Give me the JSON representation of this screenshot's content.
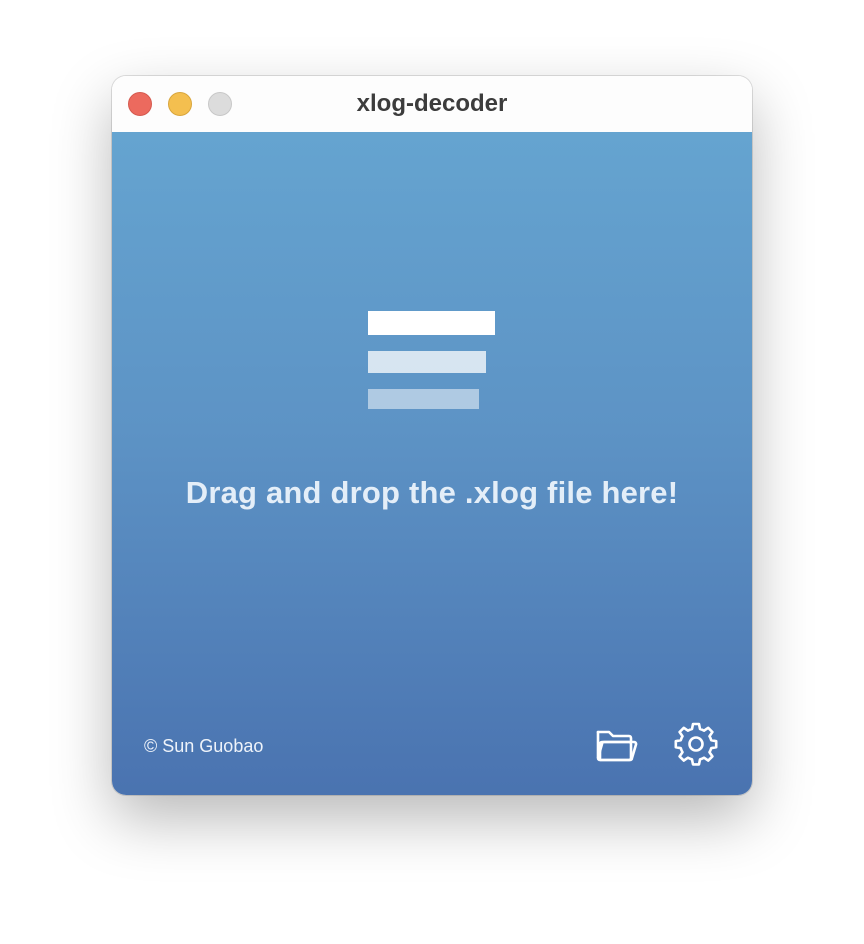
{
  "window": {
    "title": "xlog-decoder"
  },
  "drop_zone": {
    "message": "Drag and drop the .xlog file here!"
  },
  "footer": {
    "copyright": "© Sun Guobao",
    "open_icon": "folder-icon",
    "settings_icon": "gear-icon"
  },
  "colors": {
    "gradient_top": "#65a4d0",
    "gradient_bottom": "#4a73b0",
    "close": "#ec6a5e",
    "minimize": "#f4bf4f",
    "zoom": "#dcdcdc"
  }
}
